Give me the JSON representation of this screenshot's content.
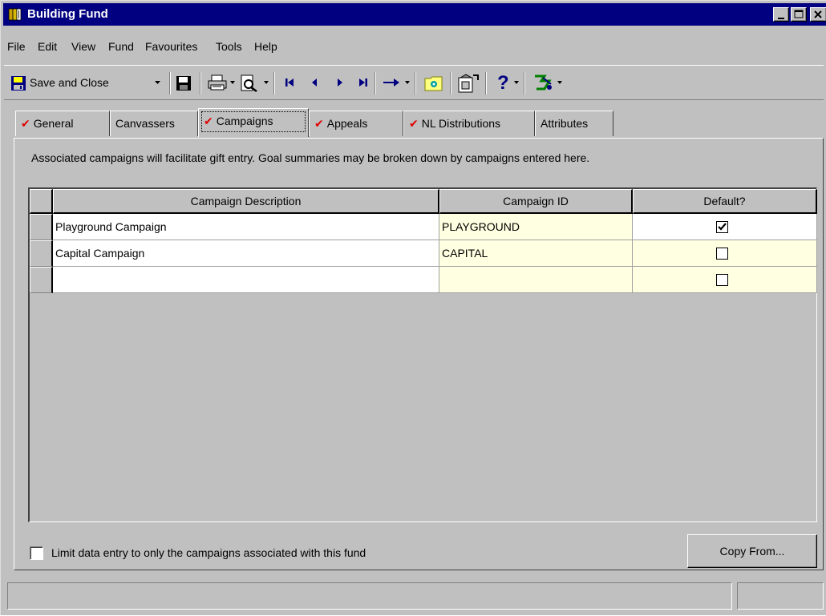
{
  "window": {
    "title": "Building Fund",
    "title_bar_color": "#000080"
  },
  "menu": {
    "items": [
      "File",
      "Edit",
      "View",
      "Fund",
      "Favourites",
      "Tools",
      "Help"
    ]
  },
  "toolbar": {
    "save_close_label": "Save and Close",
    "help_glyph": "?"
  },
  "tabs": [
    {
      "label": "General",
      "checked": true
    },
    {
      "label": "Canvassers",
      "checked": false
    },
    {
      "label": "Campaigns",
      "checked": true,
      "active": true
    },
    {
      "label": "Appeals",
      "checked": true
    },
    {
      "label": "NL Distributions",
      "checked": true
    },
    {
      "label": "Attributes",
      "checked": false
    }
  ],
  "panel": {
    "description": "Associated campaigns will facilitate gift entry. Goal summaries may be broken down by campaigns entered here."
  },
  "grid": {
    "columns": [
      "Campaign Description",
      "Campaign ID",
      "Default?"
    ],
    "rows": [
      {
        "description": "Playground Campaign",
        "id": "PLAYGROUND",
        "default": true
      },
      {
        "description": "Capital Campaign",
        "id": "CAPITAL",
        "default": false
      },
      {
        "description": "",
        "id": "",
        "default": false
      }
    ]
  },
  "bottom": {
    "limit_label": "Limit data entry to only the campaigns associated with this fund",
    "limit_checked": false,
    "copy_button": "Copy From..."
  },
  "colors": {
    "check_red": "#e00000",
    "cell_cream": "#ffffe1",
    "face": "#c0c0c0"
  }
}
